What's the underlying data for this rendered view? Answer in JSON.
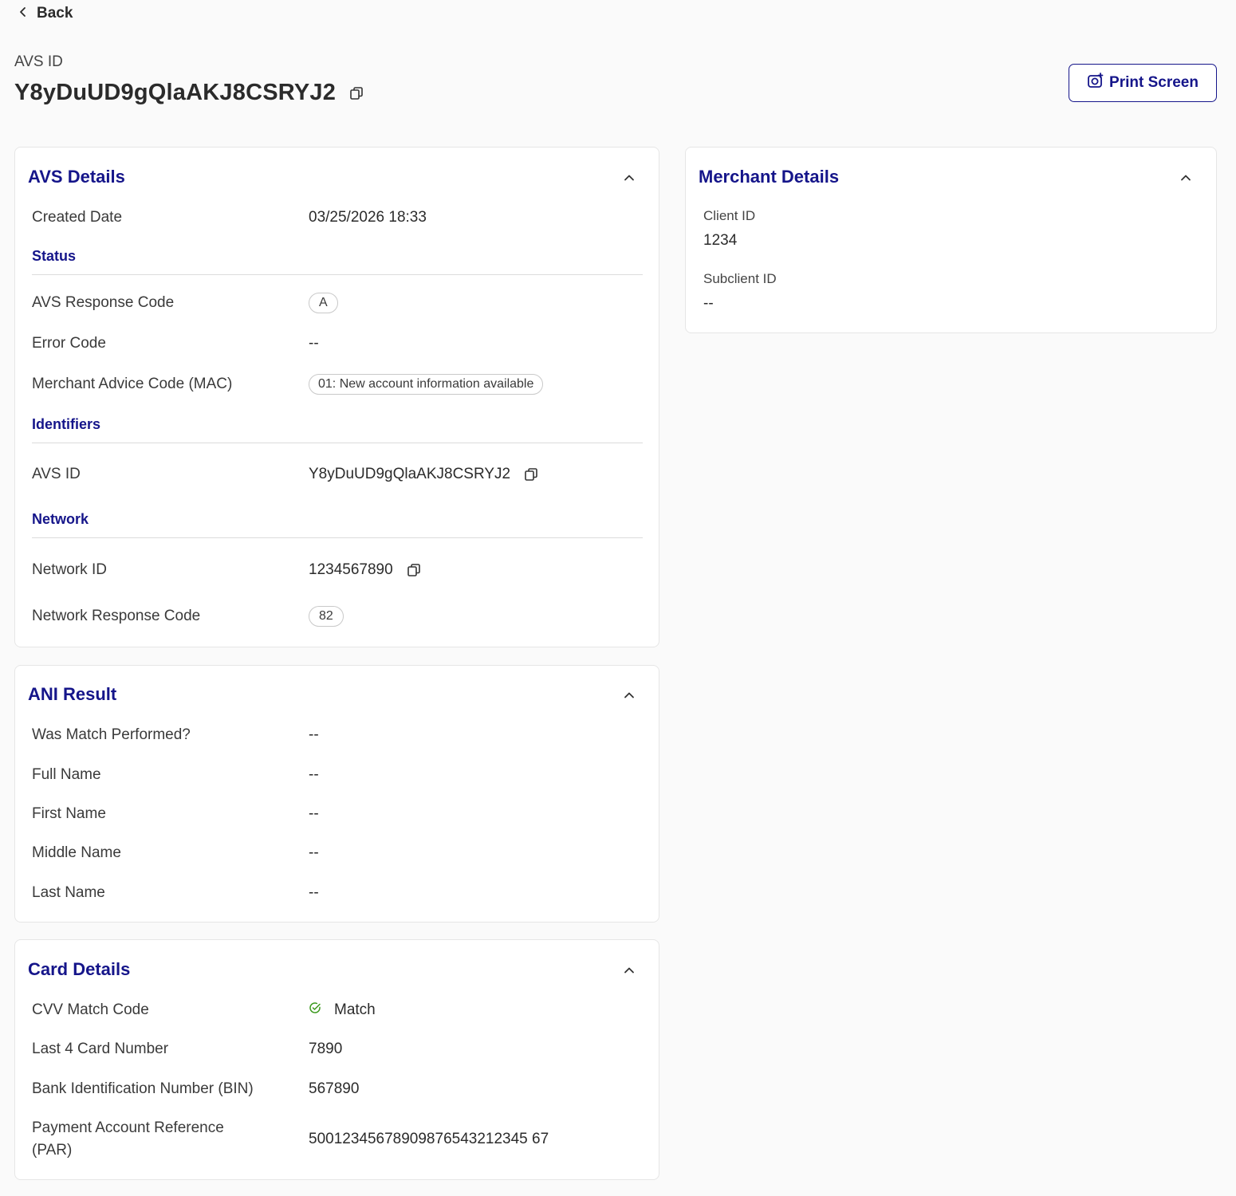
{
  "nav": {
    "back_label": "Back"
  },
  "header": {
    "id_label": "AVS ID",
    "id_value": "Y8yDuUD9gQlaAKJ8CSRYJ2",
    "print_label": "Print Screen"
  },
  "avs_details": {
    "title": "AVS Details",
    "created_label": "Created Date",
    "created_value": "03/25/2026 18:33",
    "status_section": "Status",
    "response_code_label": "AVS Response Code",
    "response_code_value": "A",
    "error_code_label": "Error Code",
    "error_code_value": "--",
    "mac_label": "Merchant Advice Code (MAC)",
    "mac_value": "01: New account information available",
    "identifiers_section": "Identifiers",
    "avs_id_label": "AVS ID",
    "avs_id_value": "Y8yDuUD9gQlaAKJ8CSRYJ2",
    "network_section": "Network",
    "network_id_label": "Network ID",
    "network_id_value": "1234567890",
    "network_response_label": "Network Response Code",
    "network_response_value": "82"
  },
  "ani_result": {
    "title": "ANI Result",
    "rows": [
      {
        "label": "Was Match Performed?",
        "value": "--"
      },
      {
        "label": "Full Name",
        "value": "--"
      },
      {
        "label": "First Name",
        "value": "--"
      },
      {
        "label": "Middle Name",
        "value": "--"
      },
      {
        "label": "Last Name",
        "value": "--"
      }
    ]
  },
  "card_details": {
    "title": "Card Details",
    "cvv_label": "CVV Match Code",
    "cvv_value": "Match",
    "last4_label": "Last 4 Card Number",
    "last4_value": "7890",
    "bin_label": "Bank Identification Number (BIN)",
    "bin_value": "567890",
    "par_label_line1": "Payment Account Reference",
    "par_label_line2": "(PAR)",
    "par_value": "50012345678909876543212345 67"
  },
  "merchant_details": {
    "title": "Merchant Details",
    "client_id_label": "Client ID",
    "client_id_value": "1234",
    "subclient_id_label": "Subclient ID",
    "subclient_id_value": "--"
  },
  "colors": {
    "accent": "#15158a",
    "match": "#3c9a1e",
    "background": "#fafafa"
  },
  "icons": [
    "chevron-left-icon",
    "copy-icon",
    "camera-plus-icon",
    "chevron-up-icon",
    "check-circle-icon"
  ]
}
